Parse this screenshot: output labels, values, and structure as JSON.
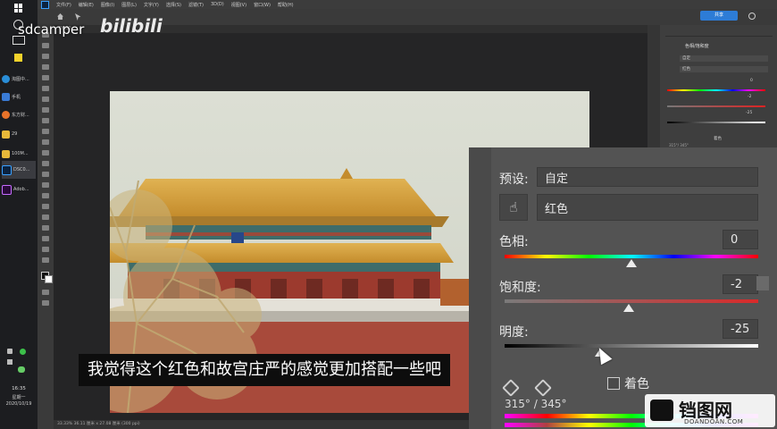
{
  "taskbar": {
    "items": [
      "淘图中...",
      "手机",
      "东方财...",
      "29",
      "100M...",
      "DSC0...",
      "Adob..."
    ],
    "time": "16:35",
    "weekday": "星期一",
    "date": "2020/10/19"
  },
  "menubar": {
    "items": [
      "文件(F)",
      "编辑(E)",
      "图像(I)",
      "图层(L)",
      "文字(Y)",
      "选择(S)",
      "滤镜(T)",
      "3D(D)",
      "视图(V)",
      "窗口(W)",
      "帮助(H)"
    ]
  },
  "share_label": "共享",
  "status": "33.33% 36.11 厘米 x 27.08 厘米 (300 ppi)",
  "watermark": {
    "uploader": "sdcamper",
    "platform": "bilibili",
    "site_name": "铛图网",
    "site_url": "DOANDOAN.COM"
  },
  "small_panel": {
    "title": "色相/饱和度",
    "preset": "自定",
    "channel": "红色",
    "hue": "0",
    "sat": "-2",
    "light": "-25",
    "range": "315°/ 345°",
    "colorize": "着色"
  },
  "panel": {
    "preset_label": "预设:",
    "preset_value": "自定",
    "channel_value": "红色",
    "hue_label": "色相:",
    "hue_value": "0",
    "hue_fraction": 0.5,
    "saturation_label": "饱和度:",
    "saturation_value": "-2",
    "saturation_fraction": 0.49,
    "lightness_label": "明度:",
    "lightness_value": "-25",
    "lightness_fraction": 0.375,
    "colorize_label": "着色",
    "range_text": "315° / 345°"
  },
  "subtitle": "我觉得这个红色和故宫庄严的感觉更加搭配一些吧",
  "colors": {
    "accent_blue": "#2d7cd6",
    "panel_bg": "#535353",
    "sky": "#d8dbd0",
    "roof": "#d6a13c",
    "wall": "#a84a3b"
  }
}
